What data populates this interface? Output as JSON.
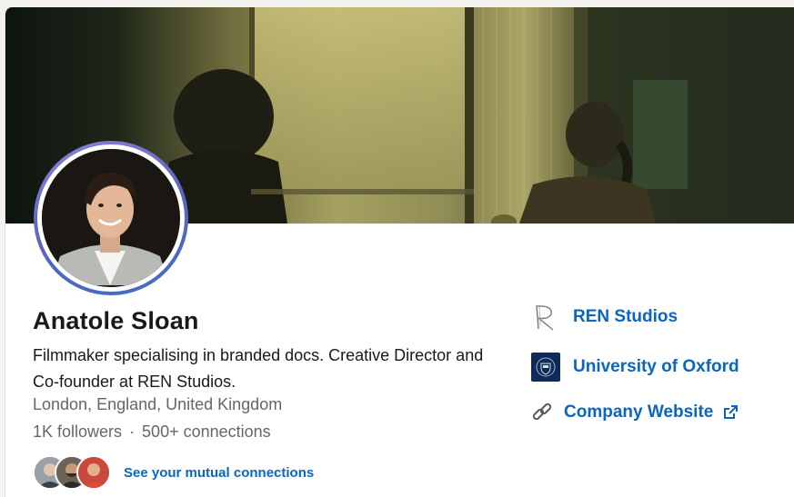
{
  "profile": {
    "name": "Anatole Sloan",
    "headline": "Filmmaker specialising in branded docs. Creative Director and Co-founder at REN Studios.",
    "location": "London, England, United Kingdom",
    "followers": "1K followers",
    "separator": "·",
    "connections": "500+ connections",
    "mutual_link": "See your mutual connections"
  },
  "sidebar": {
    "company": "REN Studios",
    "education": "University of Oxford",
    "website": "Company Website"
  },
  "colors": {
    "link": "#0a66c2",
    "text_primary": "#191919",
    "text_secondary": "#666666",
    "avatar_ring": "#5b63c0"
  },
  "icons": {
    "company_logo": "ren-studios-logo",
    "school_logo": "oxford-crest-logo",
    "website": "link-icon",
    "external": "external-link-icon"
  }
}
